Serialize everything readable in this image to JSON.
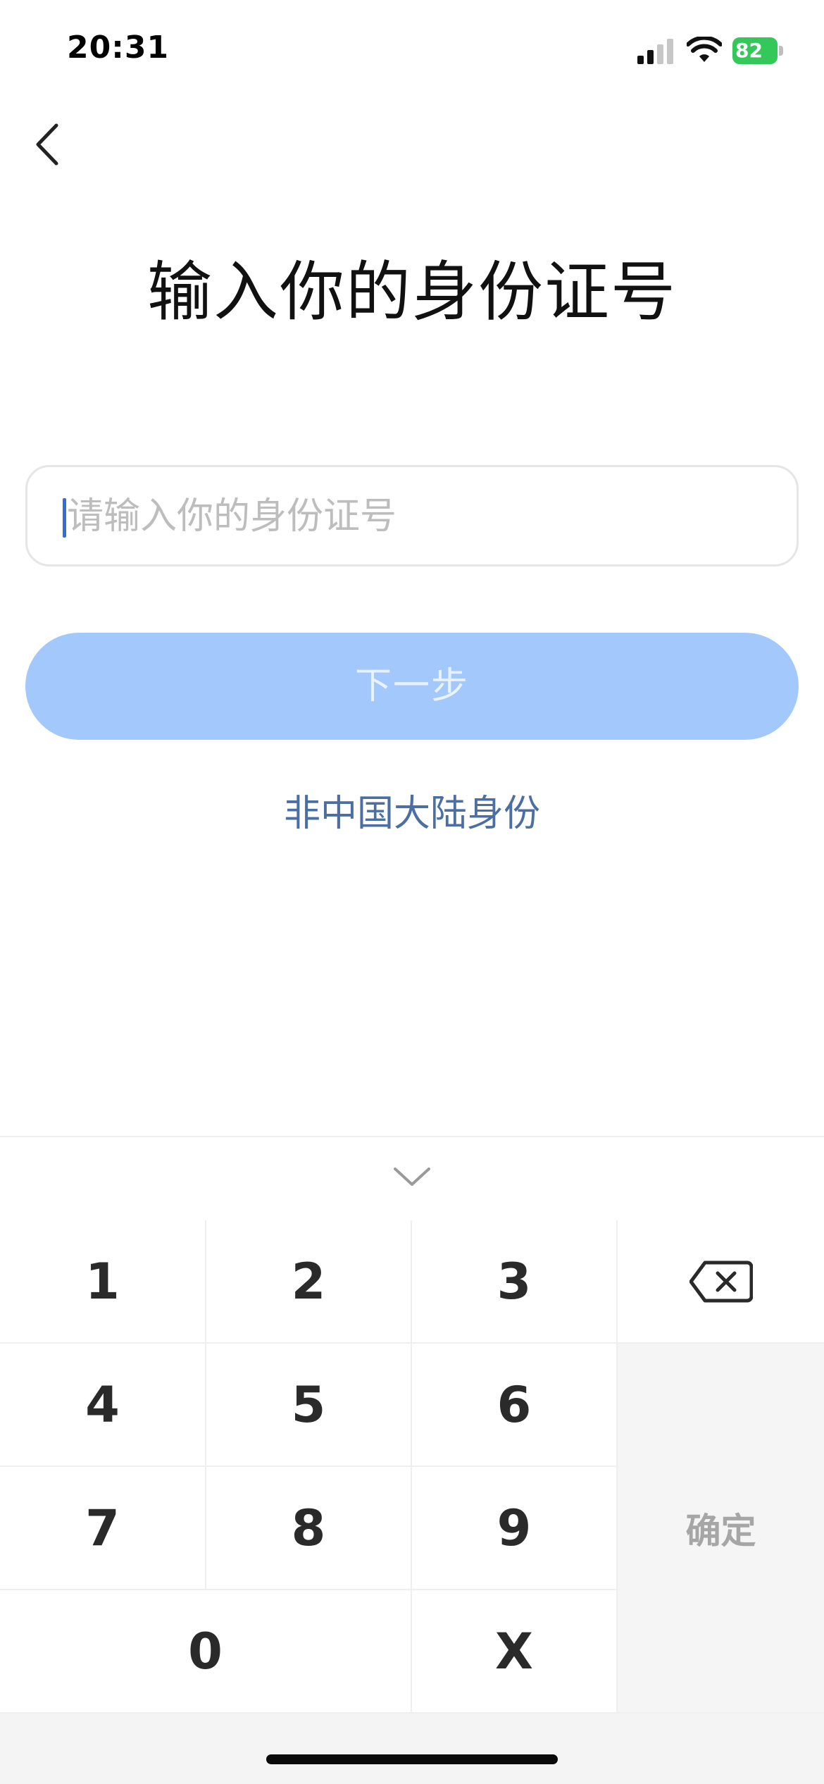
{
  "status_bar": {
    "time": "20:31",
    "battery": "82"
  },
  "page": {
    "title": "输入你的身份证号"
  },
  "id_input": {
    "value": "",
    "placeholder": "请输入你的身份证号"
  },
  "next_button": {
    "label": "下一步"
  },
  "alt_link": {
    "label": "非中国大陆身份"
  },
  "keypad": {
    "keys": [
      "1",
      "2",
      "3",
      "4",
      "5",
      "6",
      "7",
      "8",
      "9",
      "0",
      "X"
    ],
    "confirm_label": "确定"
  },
  "colors": {
    "accent": "#a3c8fb",
    "link": "#4b6ea3",
    "caret": "#2f6fd6",
    "battery": "#34c759"
  }
}
